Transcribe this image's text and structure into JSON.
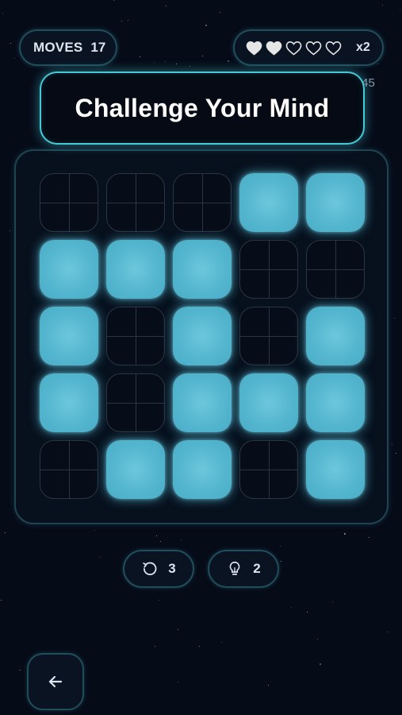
{
  "hud": {
    "moves_label": "MOVES",
    "moves_value": "17",
    "lives_total": 5,
    "lives_filled": 2,
    "multiplier": "x2",
    "timer_visible_fragment": ":45"
  },
  "banner": {
    "text": "Challenge Your Mind"
  },
  "board": {
    "rows": 5,
    "cols": 5,
    "cells": [
      [
        0,
        0,
        0,
        1,
        1
      ],
      [
        1,
        1,
        1,
        0,
        0
      ],
      [
        1,
        0,
        1,
        0,
        1
      ],
      [
        1,
        0,
        1,
        1,
        1
      ],
      [
        0,
        1,
        1,
        0,
        1
      ]
    ]
  },
  "tools": {
    "undo": {
      "icon": "undo-icon",
      "count": "3"
    },
    "hint": {
      "icon": "lightbulb-icon",
      "count": "2"
    }
  },
  "nav": {
    "back_icon": "arrow-left-icon"
  },
  "colors": {
    "background": "#060b18",
    "tile_on": "#55b6cf",
    "accent": "#45c9d6",
    "tile_off_border": "#2b3542",
    "heart_filled": "#e6e6e6"
  }
}
